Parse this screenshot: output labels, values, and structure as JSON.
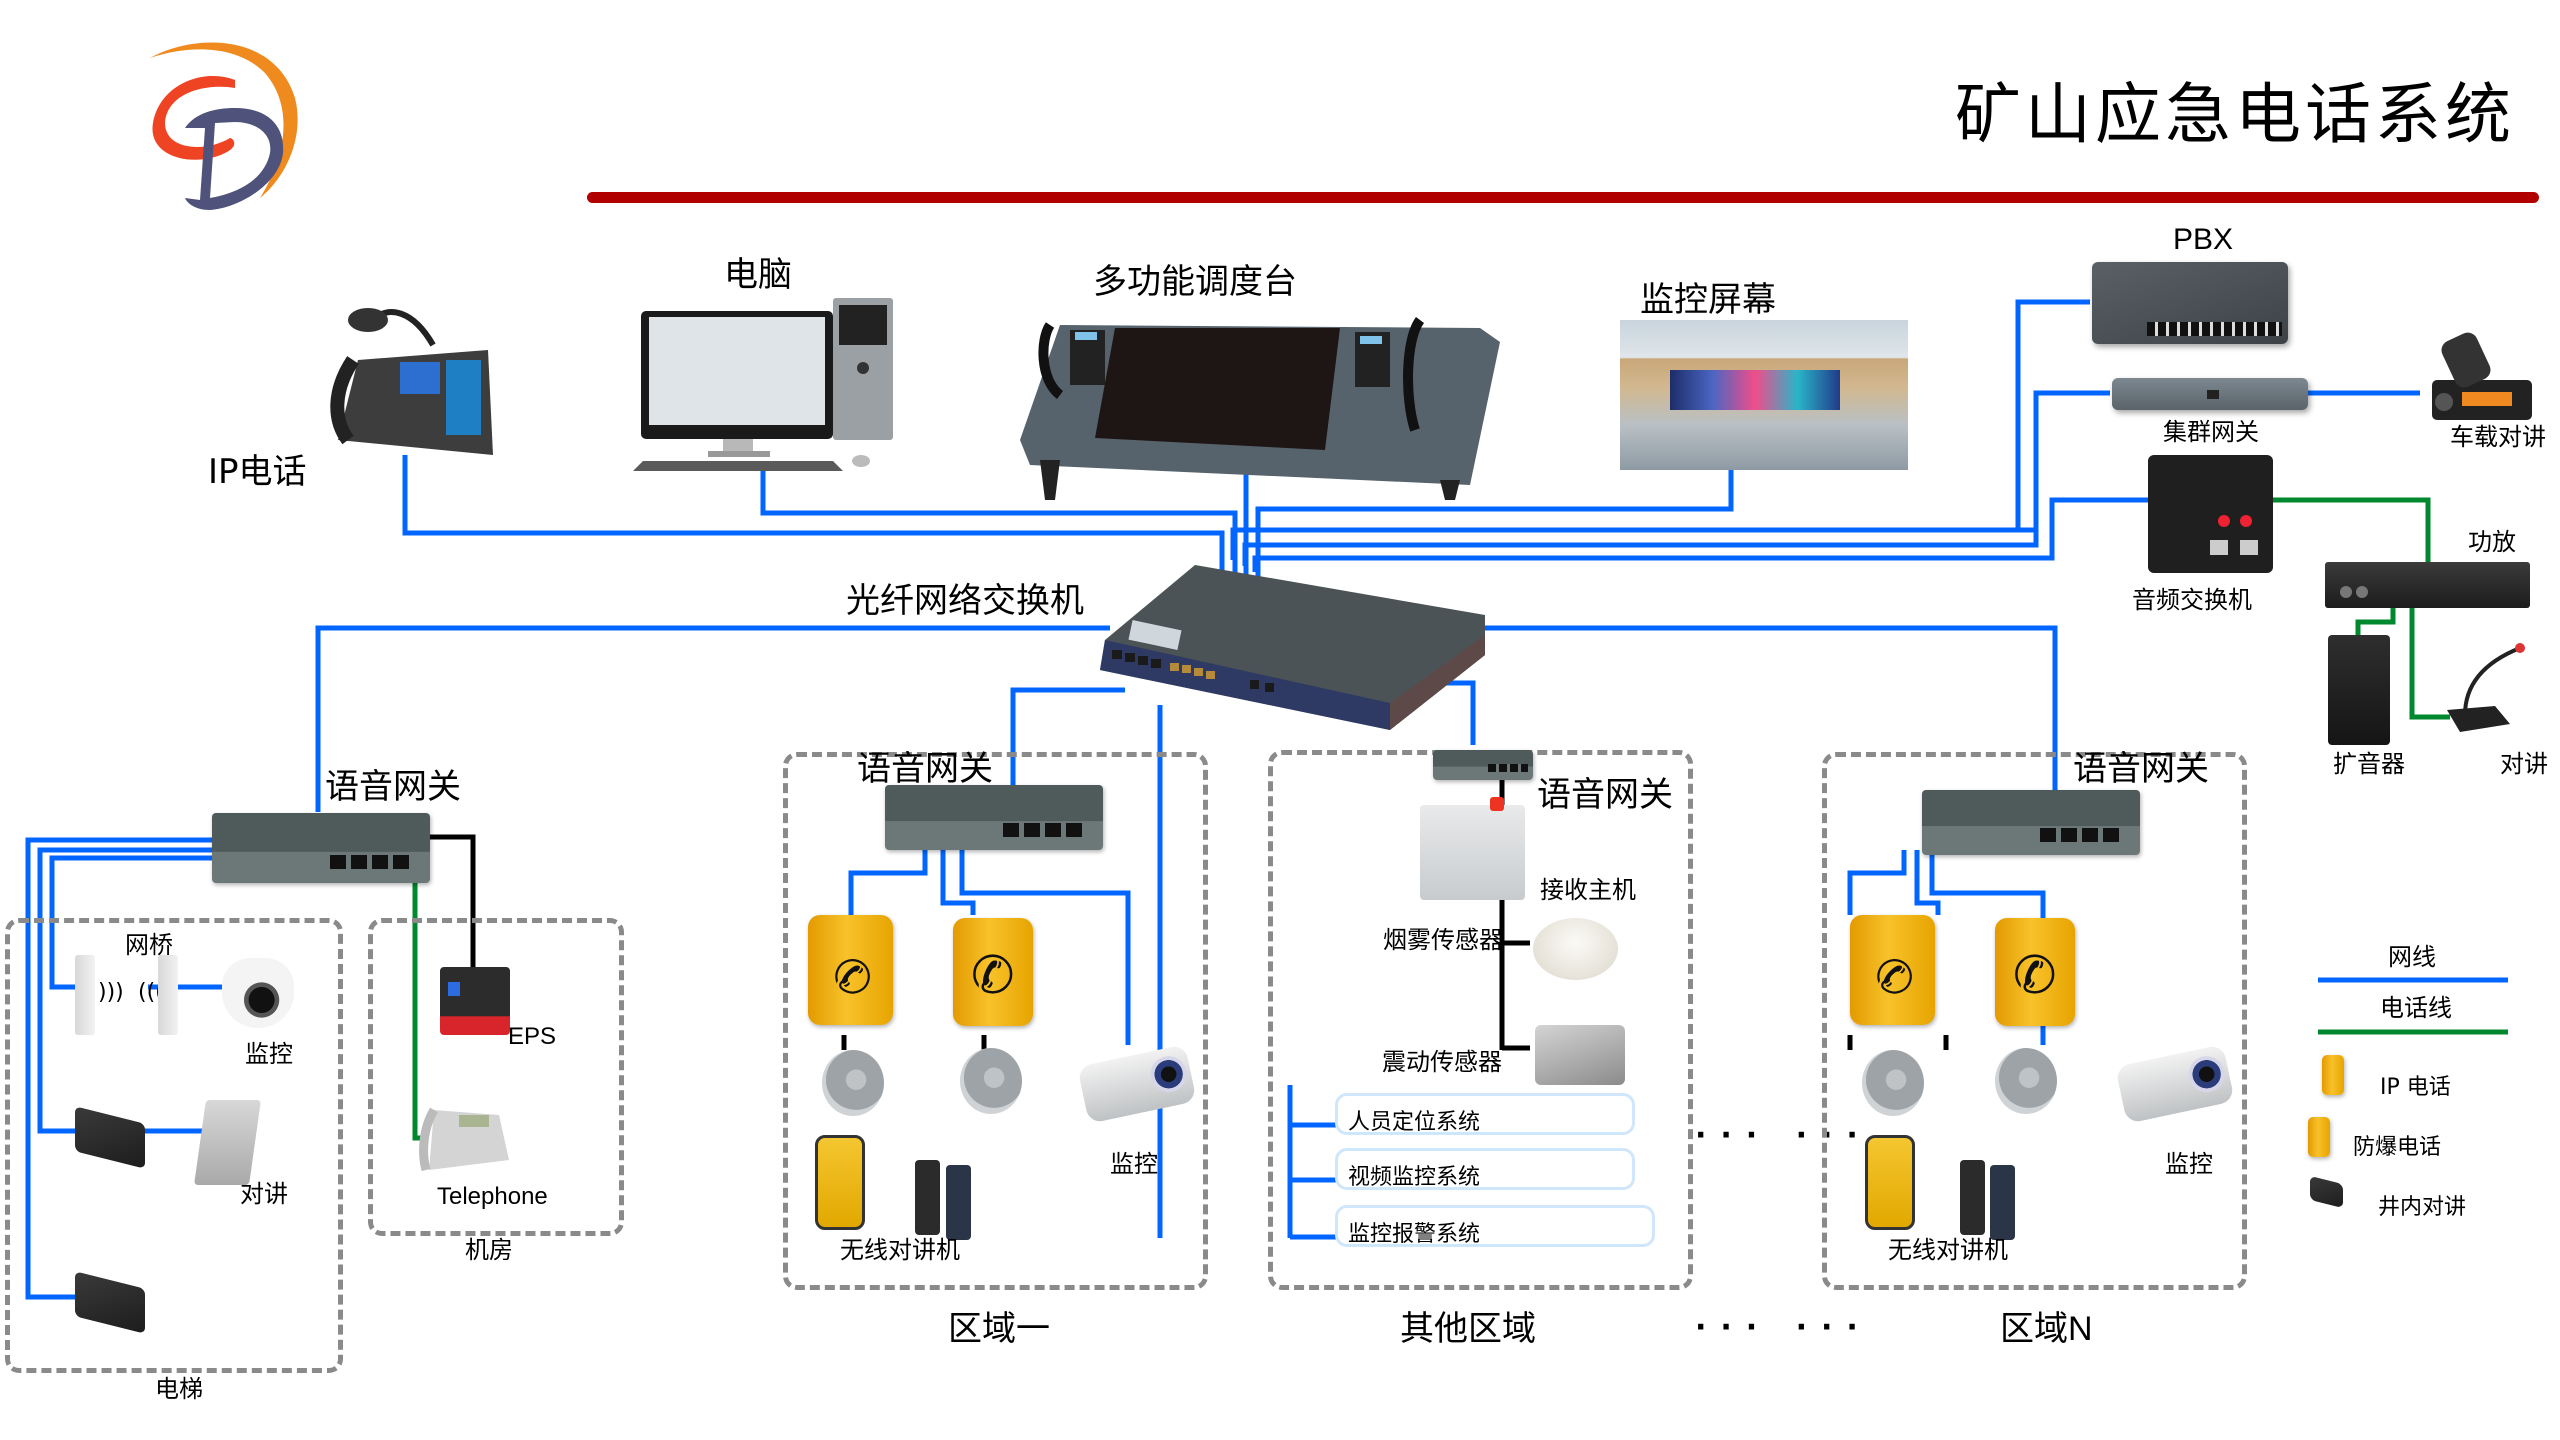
{
  "header": {
    "title": "矿山应急电话系统",
    "logo": "cd-logo-icon",
    "accent_color": "#b00000"
  },
  "colors": {
    "network_cable": "#0066ff",
    "phone_line": "#00882e",
    "black_line": "#000000",
    "zone_border": "#8a8a8a",
    "system_box_border": "#cfe6fb"
  },
  "top_devices": {
    "ip_phone": "IP电话",
    "computer": "电脑",
    "dispatch_console": "多功能调度台",
    "monitor_screen": "监控屏幕"
  },
  "core": {
    "fiber_switch": "光纤网络交换机"
  },
  "right_devices": {
    "pbx": "PBX",
    "trunk_gateway": "集群网关",
    "vehicle_radio": "车载对讲",
    "audio_switch": "音频交换机",
    "amplifier": "功放",
    "loudspeaker": "扩音器",
    "intercom": "对讲"
  },
  "left_group": {
    "voice_gateway": "语音网关",
    "bridge": "网桥",
    "camera": "监控",
    "intercom": "对讲",
    "elevator_zone": "电梯",
    "eps": "EPS",
    "telephone": "Telephone",
    "machine_room_zone": "机房"
  },
  "zone_one": {
    "voice_gateway": "语音网关",
    "camera": "监控",
    "wireless_radio": "无线对讲机",
    "zone_label": "区域一"
  },
  "other_zone": {
    "voice_gateway": "语音网关",
    "receiver_host": "接收主机",
    "smoke_sensor": "烟雾传感器",
    "vibration_sensor": "震动传感器",
    "systems": [
      "人员定位系统",
      "视频监控系统",
      "监控报警系统"
    ],
    "zone_label": "其他区域"
  },
  "zone_n": {
    "voice_gateway": "语音网关",
    "camera": "监控",
    "wireless_radio": "无线对讲机",
    "zone_label": "区域N"
  },
  "ellipsis": "··· ···",
  "legend": {
    "network_cable": "网线",
    "phone_line": "电话线",
    "items": [
      "IP 电话",
      "防爆电话",
      "井内对讲"
    ]
  }
}
